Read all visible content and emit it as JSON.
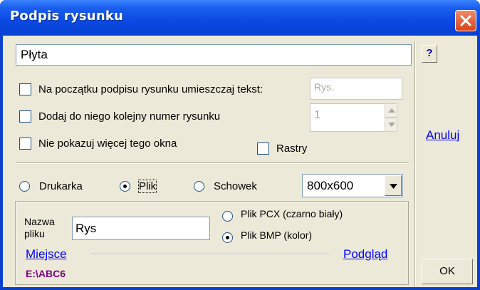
{
  "window": {
    "title": "Podpis rysunku"
  },
  "caption_input": {
    "value": "Płyta"
  },
  "options": {
    "prefix_label": "Na początku podpisu rysunku umieszczaj tekst:",
    "prefix_value": "Rys.",
    "number_label": "Dodaj do niego kolejny numer rysunku",
    "number_value": "1",
    "dont_show_label": "Nie pokazuj więcej tego okna",
    "rasters_label": "Rastry"
  },
  "side": {
    "help_label": "?",
    "cancel_label": "Anuluj",
    "ok_label": "OK"
  },
  "output": {
    "printer_label": "Drukarka",
    "file_label": "Plik",
    "clipboard_label": "Schowek",
    "selected": "Plik",
    "resolution": "800x600"
  },
  "file_group": {
    "name_label_line1": "Nazwa",
    "name_label_line2": "pliku",
    "name_value": "Rys",
    "pcx_label": "Plik PCX (czarno biały)",
    "bmp_label": "Plik BMP (kolor)",
    "selected_format": "Plik BMP (kolor)",
    "location_link": "Miejsce",
    "preview_link": "Podgląd",
    "path": "E:\\ABC6"
  },
  "colors": {
    "titlebar": "#0a49e2",
    "dialog_bg": "#ece9d8",
    "link": "#0000ff",
    "path": "#800080"
  }
}
